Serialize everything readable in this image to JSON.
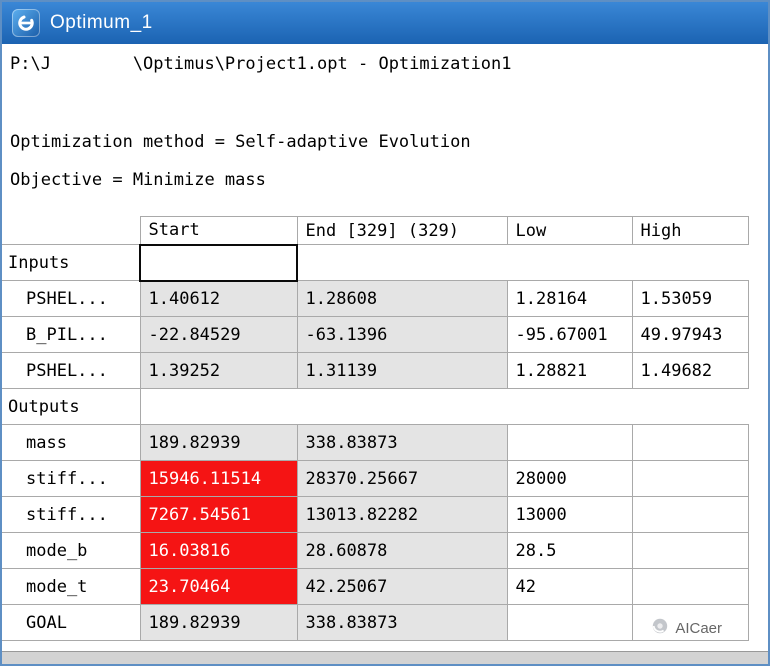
{
  "window": {
    "title": "Optimum_1"
  },
  "header": {
    "path_line": "P:\\J        \\Optimus\\Project1.opt - Optimization1",
    "method_line": "Optimization method = Self-adaptive Evolution",
    "objective_line": "Objective = Minimize mass"
  },
  "table": {
    "headers": {
      "start": "Start",
      "end": "End [329] (329)",
      "low": "Low",
      "high": "High"
    },
    "sections": {
      "inputs": "Inputs",
      "outputs": "Outputs"
    },
    "rows": [
      {
        "label": "PSHEL...",
        "start": "1.40612",
        "end": "1.28608",
        "low": "1.28164",
        "high": "1.53059"
      },
      {
        "label": "B_PIL...",
        "start": "-22.84529",
        "end": "-63.1396",
        "low": "-95.67001",
        "high": "49.97943"
      },
      {
        "label": "PSHEL...",
        "start": "1.39252",
        "end": "1.31139",
        "low": "1.28821",
        "high": "1.49682"
      },
      {
        "label": "mass",
        "start": "189.82939",
        "end": "338.83873",
        "low": "",
        "high": ""
      },
      {
        "label": "stiff...",
        "start": "15946.11514",
        "end": "28370.25667",
        "low": "28000",
        "high": ""
      },
      {
        "label": "stiff...",
        "start": "7267.54561",
        "end": "13013.82282",
        "low": "13000",
        "high": ""
      },
      {
        "label": "mode_b",
        "start": "16.03816",
        "end": "28.60878",
        "low": "28.5",
        "high": ""
      },
      {
        "label": "mode_t",
        "start": "23.70464",
        "end": "42.25067",
        "low": "42",
        "high": ""
      },
      {
        "label": "GOAL",
        "start": "189.82939",
        "end": "338.83873",
        "low": "",
        "high": ""
      }
    ]
  },
  "watermark": {
    "text": "AICaer"
  },
  "colors": {
    "titlebar": "#1b63b2",
    "cell_gray": "#e4e4e4",
    "violation_red": "#f51414",
    "grid": "#a9a9a9"
  }
}
